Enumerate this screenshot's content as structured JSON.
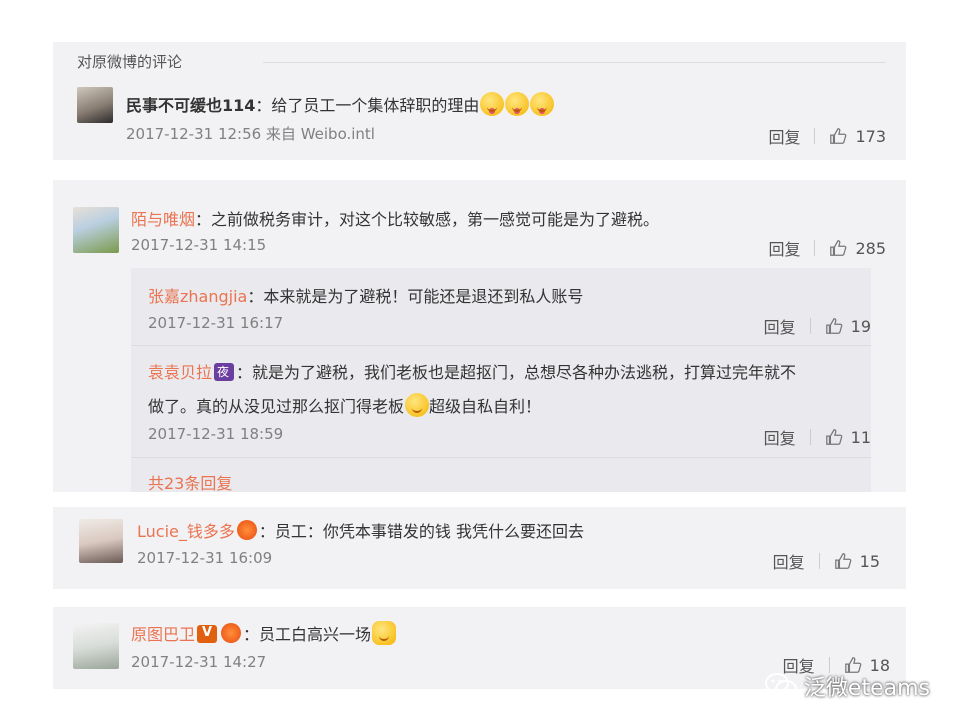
{
  "section_header": "对原微博的评论",
  "comments": [
    {
      "user": "民事不可缓也114",
      "text": "：给了员工一个集体辞职的理由",
      "time": "2017-12-31 12:56 来自 Weibo.intl",
      "reply_label": "回复",
      "likes": "173"
    },
    {
      "user": "陌与唯烟",
      "text": "：之前做税务审计，对这个比较敏感，第一感觉可能是为了避税。",
      "time": "2017-12-31 14:15",
      "reply_label": "回复",
      "likes": "285",
      "replies": [
        {
          "user": "张嘉zhangjia",
          "text": "：本来就是为了避税！可能还是退还到私人账号",
          "time": "2017-12-31 16:17",
          "reply_label": "回复",
          "likes": "19"
        },
        {
          "user": "袁袁贝拉",
          "text_line1": "：就是为了避税，我们老板也是超抠门，总想尽各种办法逃税，打算过完年就不",
          "text_line2a": "做了。真的从没见过那么抠门得老板",
          "text_line2b": "超级自私自利！",
          "time": "2017-12-31 18:59",
          "reply_label": "回复",
          "likes": "11"
        }
      ],
      "more_replies": "共23条回复"
    },
    {
      "user": "Lucie_钱多多",
      "text": "：员工：你凭本事错发的钱 我凭什么要还回去",
      "time": "2017-12-31 16:09",
      "reply_label": "回复",
      "likes": "15"
    },
    {
      "user": "原图巴卫",
      "text": "：员工白高兴一场",
      "time": "2017-12-31 14:27",
      "reply_label": "回复",
      "likes": "18"
    }
  ],
  "watermark": "泛微eteams",
  "colors": {
    "panel_bg": "#f2f2f5",
    "name": "#eb7350",
    "meta": "#808080"
  }
}
